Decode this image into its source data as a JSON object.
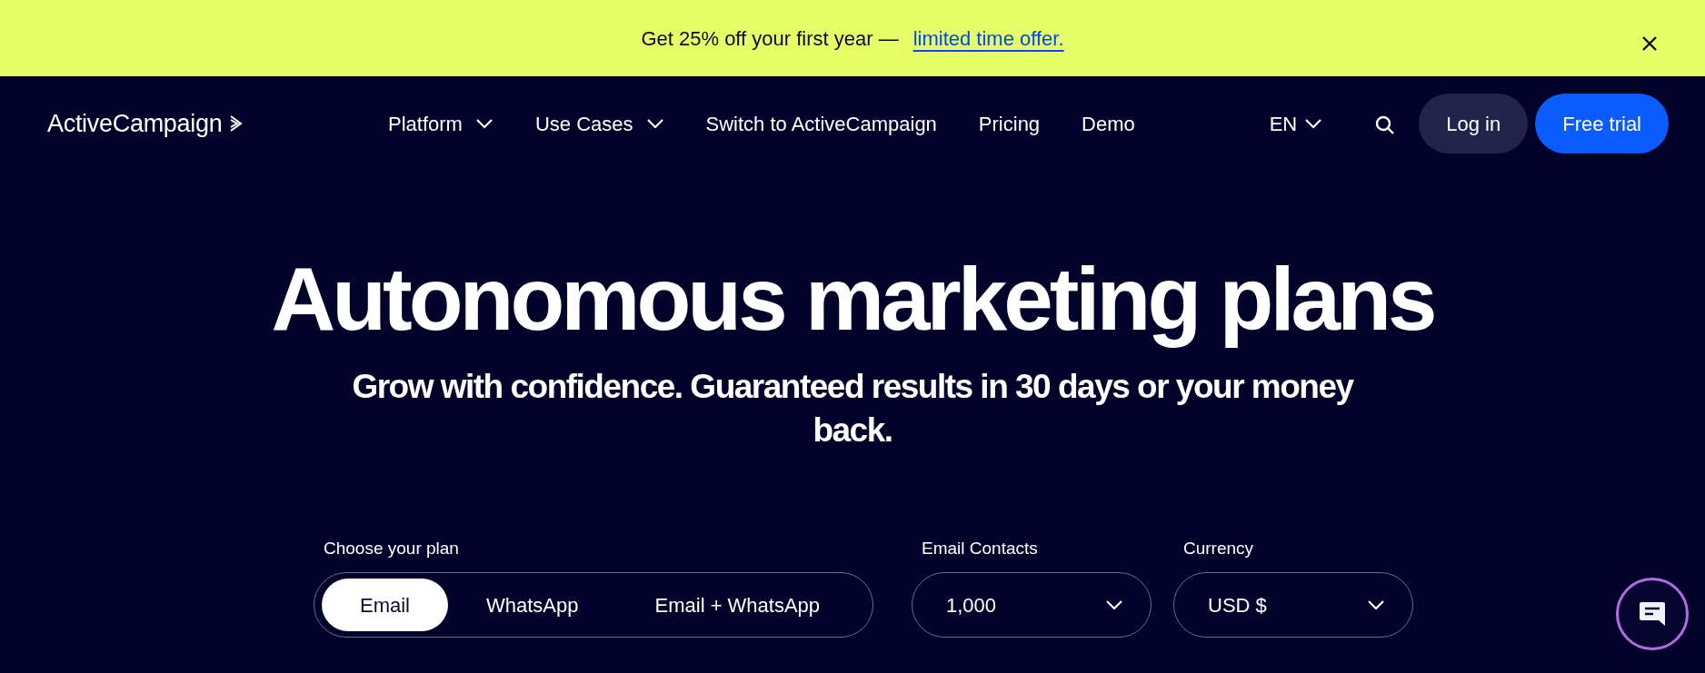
{
  "banner": {
    "text": "Get 25% off your first year —",
    "link": "limited time offer."
  },
  "navbar": {
    "logo": "ActiveCampaign",
    "items": [
      {
        "label": "Platform",
        "dropdown": true
      },
      {
        "label": "Use Cases",
        "dropdown": true
      },
      {
        "label": "Switch to ActiveCampaign",
        "dropdown": false
      },
      {
        "label": "Pricing",
        "dropdown": false
      },
      {
        "label": "Demo",
        "dropdown": false
      }
    ],
    "language": "EN",
    "login": "Log in",
    "cta": "Free trial"
  },
  "hero": {
    "title": "Autonomous marketing plans",
    "subtitle": "Grow with confidence. Guaranteed results in 30 days or your money back."
  },
  "plan": {
    "label": "Choose your plan",
    "options": [
      {
        "label": "Email",
        "selected": true
      },
      {
        "label": "WhatsApp",
        "selected": false
      },
      {
        "label": "Email + WhatsApp",
        "selected": false
      }
    ]
  },
  "contacts": {
    "label": "Email Contacts",
    "value": "1,000"
  },
  "currency": {
    "label": "Currency",
    "value": "USD $"
  }
}
